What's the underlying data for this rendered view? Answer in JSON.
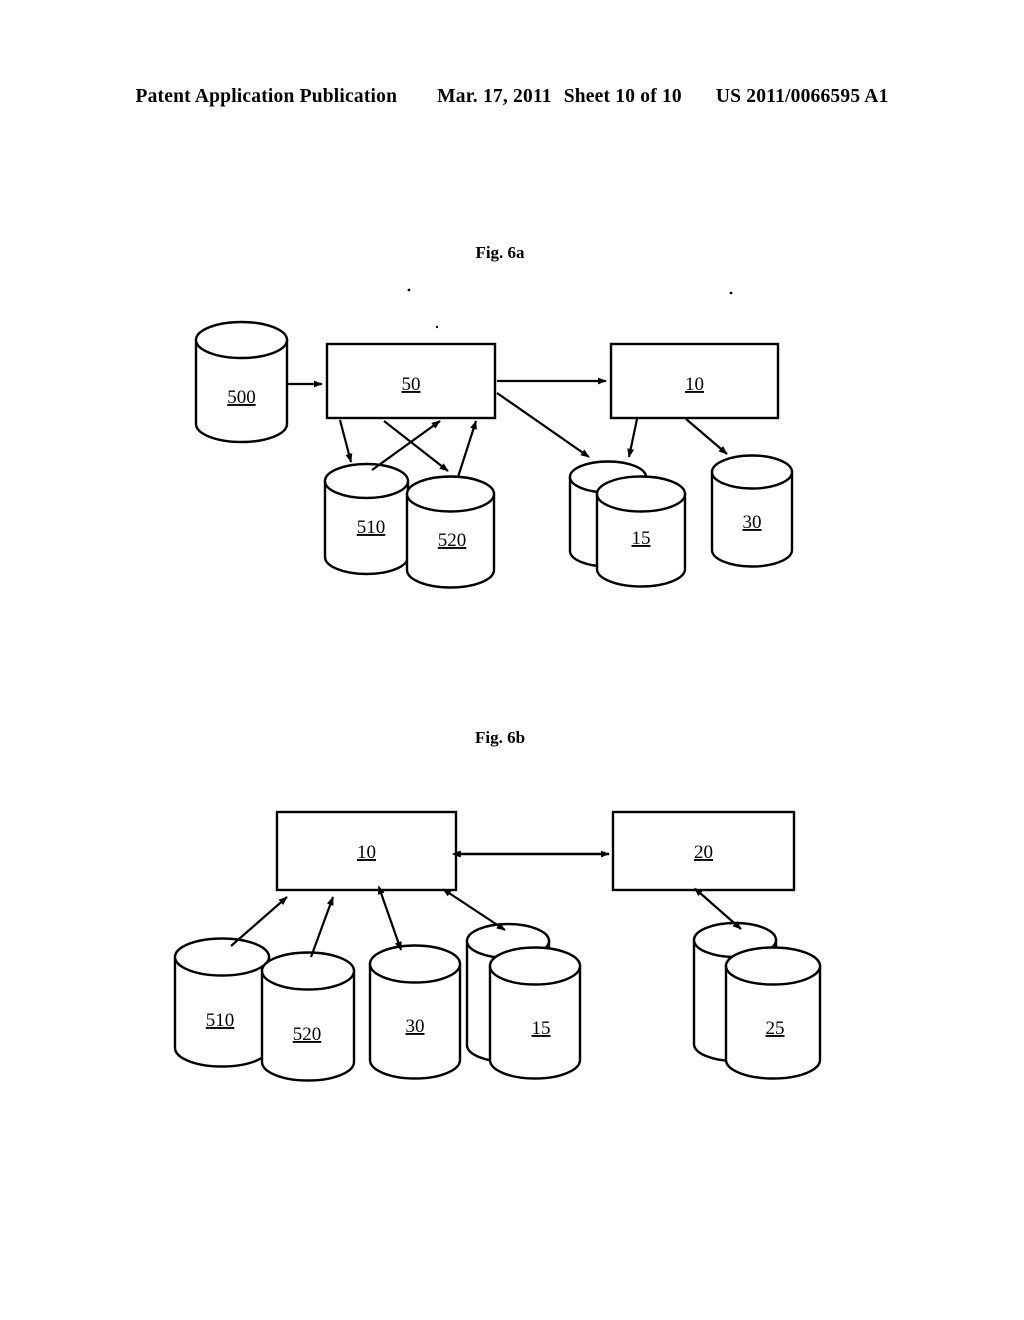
{
  "document": {
    "header": {
      "publication": "Patent Application Publication",
      "date": "Mar. 17, 2011",
      "sheet": "Sheet 10 of 10",
      "patent_number": "US 2011/0066595 A1"
    },
    "page_background": "#ffffff",
    "ink_color": "#000000"
  },
  "figures": [
    {
      "id": "fig-6a",
      "caption": "Fig. 6a",
      "nodes": {
        "box_50": "50",
        "box_10": "10",
        "cyl_500": "500",
        "cyl_510": "510",
        "cyl_520": "520",
        "cyl_15": "15",
        "cyl_30": "30"
      }
    },
    {
      "id": "fig-6b",
      "caption": "Fig. 6b",
      "nodes": {
        "box_10": "10",
        "box_20": "20",
        "cyl_510": "510",
        "cyl_520": "520",
        "cyl_30": "30",
        "cyl_15": "15",
        "cyl_25": "25"
      }
    }
  ]
}
